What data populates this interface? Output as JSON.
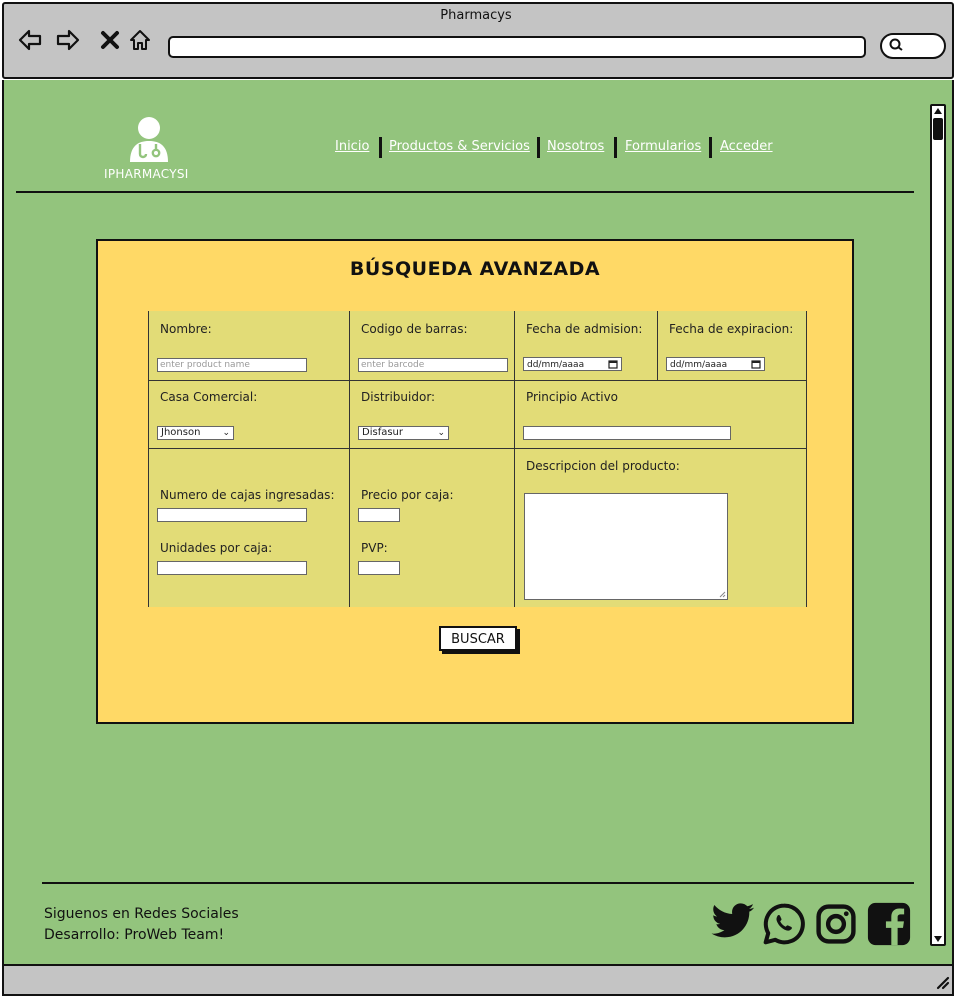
{
  "window": {
    "title": "Pharmacys"
  },
  "header": {
    "logo_text": "IPHARMACYSI",
    "nav": [
      "Inicio",
      "Productos & Servicios",
      "Nosotros",
      "Formularios",
      "Acceder"
    ]
  },
  "form": {
    "title": "BÚSQUEDA AVANZADA",
    "nombre": {
      "label": "Nombre:",
      "placeholder": "enter product name"
    },
    "codigo": {
      "label": "Codigo de barras:",
      "placeholder": "enter barcode"
    },
    "fecha_admision": {
      "label": "Fecha de admision:",
      "value": "dd/mm/aaaa"
    },
    "fecha_expiracion": {
      "label": "Fecha de expiracion:",
      "value": "dd/mm/aaaa"
    },
    "casa_comercial": {
      "label": "Casa Comercial:",
      "selected": "Jhonson"
    },
    "distribuidor": {
      "label": "Distribuidor:",
      "selected": "Disfasur"
    },
    "principio_activo": {
      "label": "Principio Activo"
    },
    "cajas_ingresadas": {
      "label": "Numero de cajas ingresadas:"
    },
    "precio_caja": {
      "label": "Precio por caja:"
    },
    "unidades_caja": {
      "label": "Unidades por caja:"
    },
    "pvp": {
      "label": "PVP:"
    },
    "descripcion": {
      "label": "Descripcion del producto:"
    },
    "search_button": "BUSCAR"
  },
  "footer": {
    "line1": "Siguenos en Redes Sociales",
    "line2": "Desarrollo: ProWeb Team!",
    "social_icons": [
      "twitter-icon",
      "whatsapp-icon",
      "instagram-icon",
      "facebook-icon"
    ]
  },
  "colors": {
    "page_bg": "#93c47d",
    "panel_bg": "#ffd966",
    "form_bg": "#e2dc77",
    "chrome": "#c4c4c4"
  }
}
